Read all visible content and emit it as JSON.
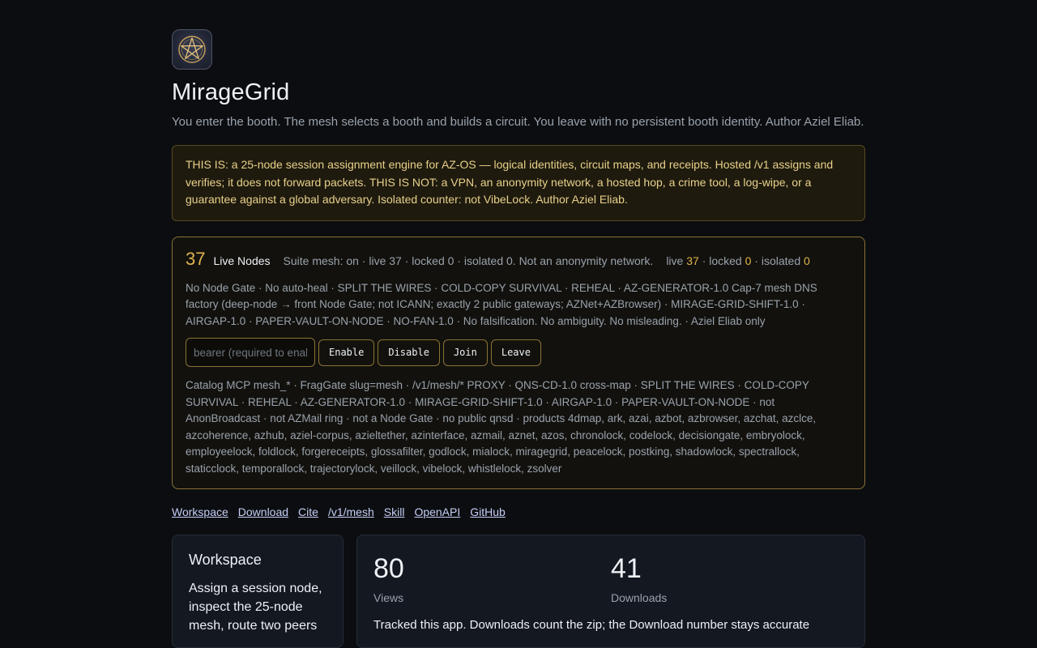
{
  "app": {
    "title": "MirageGrid",
    "subtitle": "You enter the booth. The mesh selects a booth and builds a circuit. You leave with no persistent booth identity. Author Aziel Eliab."
  },
  "notice": "THIS IS: a 25-node session assignment engine for AZ-OS — logical identities, circuit maps, and receipts. Hosted /v1 assigns and verifies; it does not forward packets. THIS IS NOT: a VPN, an anonymity network, a hosted hop, a crime tool, a log-wipe, or a guarantee against a global adversary. Isolated counter: not VibeLock. Author Aziel Eliab.",
  "mesh": {
    "live_count": "37",
    "live_label": "Live Nodes",
    "suite_status": "Suite mesh: on · live 37 · locked 0 · isolated 0. Not an anonymity network.",
    "live_word": "live",
    "live_value": "37",
    "locked_word": "· locked",
    "locked_value": "0",
    "isolated_word": "· isolated",
    "isolated_value": "0",
    "description": "No Node Gate · No auto-heal · SPLIT THE WIRES · COLD-COPY SURVIVAL · REHEAL · AZ-GENERATOR-1.0 Cap-7 mesh DNS factory (deep-node → front Node Gate; not ICANN; exactly 2 public gateways; AZNet+AZBrowser) · MIRAGE-GRID-SHIFT-1.0 · AIRGAP-1.0 · PAPER-VAULT-ON-NODE · NO-FAN-1.0 · No falsification. No ambiguity. No misleading. · Aziel Eliab only",
    "bearer_placeholder": "bearer (required to enable)",
    "buttons": {
      "enable": "Enable",
      "disable": "Disable",
      "join": "Join",
      "leave": "Leave"
    },
    "catalog": "Catalog MCP mesh_* · FragGate slug=mesh · /v1/mesh/* PROXY · QNS-CD-1.0 cross-map · SPLIT THE WIRES · COLD-COPY SURVIVAL · REHEAL · AZ-GENERATOR-1.0 · MIRAGE-GRID-SHIFT-1.0 · AIRGAP-1.0 · PAPER-VAULT-ON-NODE · not AnonBroadcast · not AZMail ring · not a Node Gate · no public qnsd · products 4dmap, ark, azai, azbot, azbrowser, azchat, azclce, azcoherence, azhub, aziel-corpus, azieltether, azinterface, azmail, aznet, azos, chronolock, codelock, decisiongate, embryolock, employeelock, foldlock, forgereceipts, glossafilter, godlock, mialock, miragegrid, peacelock, postking, shadowlock, spectrallock, staticclock, temporallock, trajectorylock, veillock, vibelock, whistlelock, zsolver"
  },
  "links": {
    "workspace": "Workspace",
    "download": "Download",
    "cite": "Cite",
    "v1_mesh": "/v1/mesh",
    "skill": "Skill",
    "openapi": "OpenAPI",
    "github": "GitHub"
  },
  "workspace_card": {
    "title": "Workspace",
    "description": "Assign a session node, inspect the 25-node mesh, route two peers"
  },
  "stats": {
    "views_value": "80",
    "views_label": "Views",
    "downloads_value": "41",
    "downloads_label": "Downloads",
    "note": "Tracked this app. Downloads count the zip; the Download number stays accurate"
  },
  "colors": {
    "accent": "#e0b34e",
    "panel_border": "#8a7236",
    "notice_text": "#e9d18a",
    "link": "#c5cdf5"
  },
  "icons": {
    "logo": "pentagram-icon"
  }
}
